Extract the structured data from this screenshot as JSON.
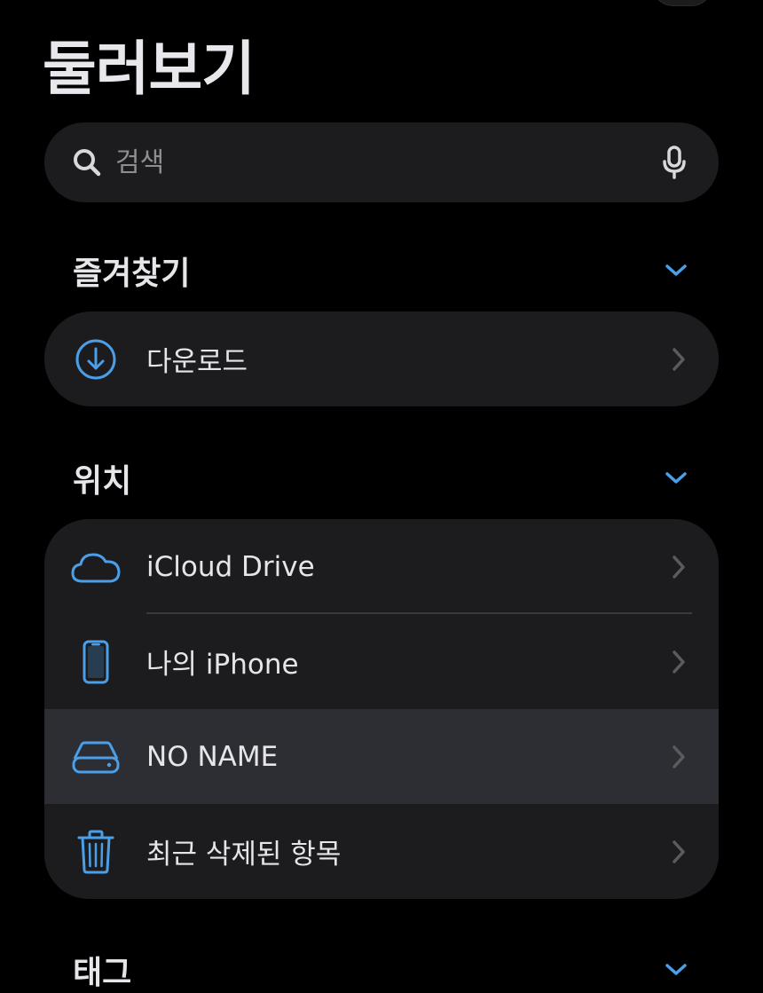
{
  "header": {
    "title": "둘러보기"
  },
  "search": {
    "placeholder": "검색"
  },
  "sections": {
    "favorites": {
      "title": "즐겨찾기",
      "items": [
        {
          "label": "다운로드",
          "icon": "download-icon"
        }
      ]
    },
    "locations": {
      "title": "위치",
      "items": [
        {
          "label": "iCloud Drive",
          "icon": "cloud-icon"
        },
        {
          "label": "나의 iPhone",
          "icon": "iphone-icon"
        },
        {
          "label": "NO NAME",
          "icon": "drive-icon",
          "selected": true
        },
        {
          "label": "최근 삭제된 항목",
          "icon": "trash-icon"
        }
      ]
    },
    "tags": {
      "title": "태그"
    }
  },
  "colors": {
    "accent": "#4a9fe8",
    "background": "#000000",
    "group": "#1c1c1e",
    "selected_row": "#2d2e33",
    "chevron": "#5a5a5f"
  }
}
